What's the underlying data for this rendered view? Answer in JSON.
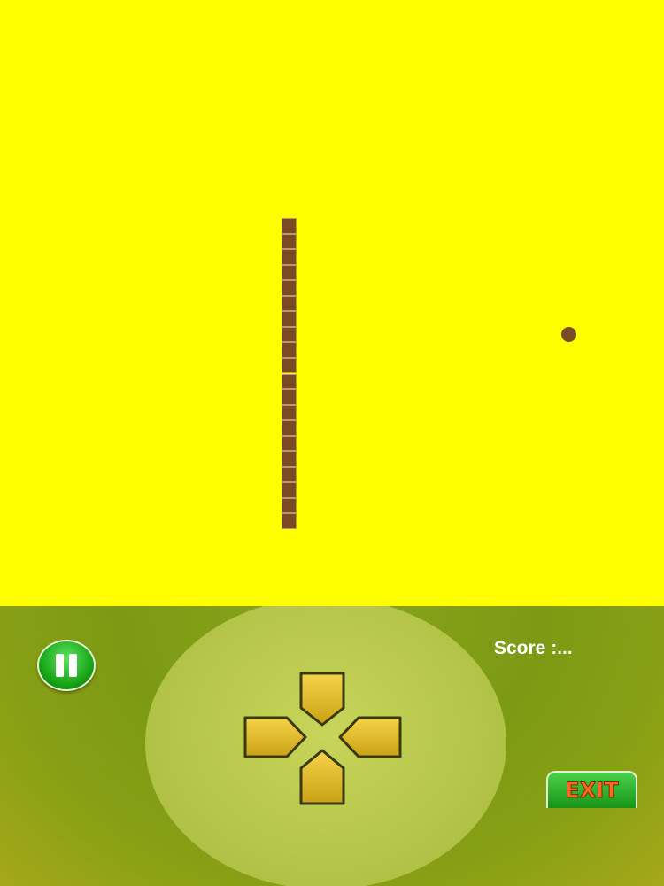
{
  "game": {
    "board_color": "#ffff00",
    "snake_color": "#7a4a22",
    "food_color": "#7a4a22",
    "snake_length": 20
  },
  "hud": {
    "score_label": "Score :...",
    "exit_label": "EXIT"
  },
  "controls": {
    "dpad": [
      "up-arrow-icon",
      "left-arrow-icon",
      "right-arrow-icon",
      "down-arrow-icon"
    ],
    "pause_icon": "pause-icon"
  }
}
